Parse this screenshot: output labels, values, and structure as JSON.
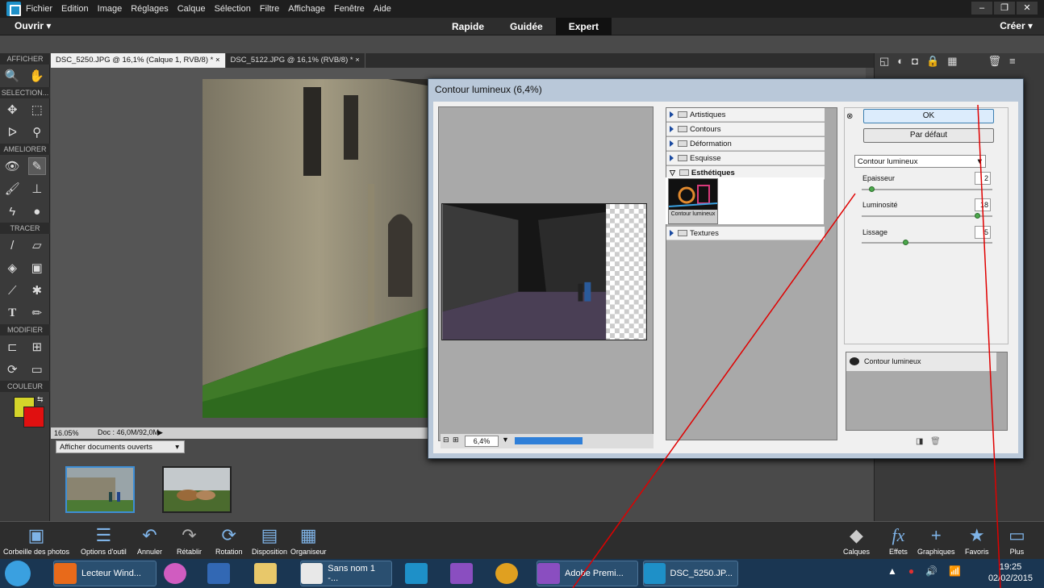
{
  "menubar": {
    "items": [
      "Fichier",
      "Edition",
      "Image",
      "Réglages",
      "Calque",
      "Sélection",
      "Filtre",
      "Affichage",
      "Fenêtre",
      "Aide"
    ]
  },
  "modebar": {
    "open_label": "Ouvrir",
    "tabs": [
      "Rapide",
      "Guidée",
      "Expert"
    ],
    "active_tab": "Expert",
    "create_label": "Créer"
  },
  "toolbox": {
    "sections": [
      "AFFICHER",
      "SELECTION...",
      "AMELIORER",
      "TRACER",
      "MODIFIER",
      "COULEUR"
    ],
    "foreground_color": "#d4d42a",
    "background_color": "#e01010"
  },
  "doc_tabs": [
    {
      "label": "DSC_5250.JPG @ 16,1% (Calque 1, RVB/8) *"
    },
    {
      "label": "DSC_5122.JPG @ 16,1% (RVB/8) *"
    }
  ],
  "status": {
    "zoom": "16.05%",
    "doc_size": "Doc : 46,0M/92,0M",
    "open_docs": "Afficher documents ouverts"
  },
  "dialog": {
    "title": "Contour lumineux (6,4%)",
    "zoom": "6,4%",
    "categories": [
      "Artistiques",
      "Contours",
      "Déformation",
      "Esquisse",
      "Esthétiques",
      "Textures"
    ],
    "open_category": "Esthétiques",
    "filter_thumb_label": "Contour lumineux",
    "ok_label": "OK",
    "default_label": "Par défaut",
    "selected_filter": "Contour lumineux",
    "params": [
      {
        "label": "Epaisseur",
        "value": "2",
        "level": 0.06
      },
      {
        "label": "Luminosité",
        "value": "18",
        "level": 0.9
      },
      {
        "label": "Lissage",
        "value": "5",
        "level": 0.33
      }
    ],
    "effect_layer": "Contour lumineux"
  },
  "bottombar": {
    "left": [
      "Corbeille des photos",
      "Options d'outil",
      "Annuler",
      "Rétablir",
      "Rotation",
      "Disposition",
      "Organiseur"
    ],
    "right": [
      "Calques",
      "Effets",
      "Graphiques",
      "Favoris",
      "Plus"
    ]
  },
  "taskbar": {
    "tasks": [
      "Lecteur Wind...",
      "Sans nom 1 -...",
      "Adobe Premi...",
      "DSC_5250.JP..."
    ],
    "time": "19:25",
    "date": "02/02/2015"
  }
}
